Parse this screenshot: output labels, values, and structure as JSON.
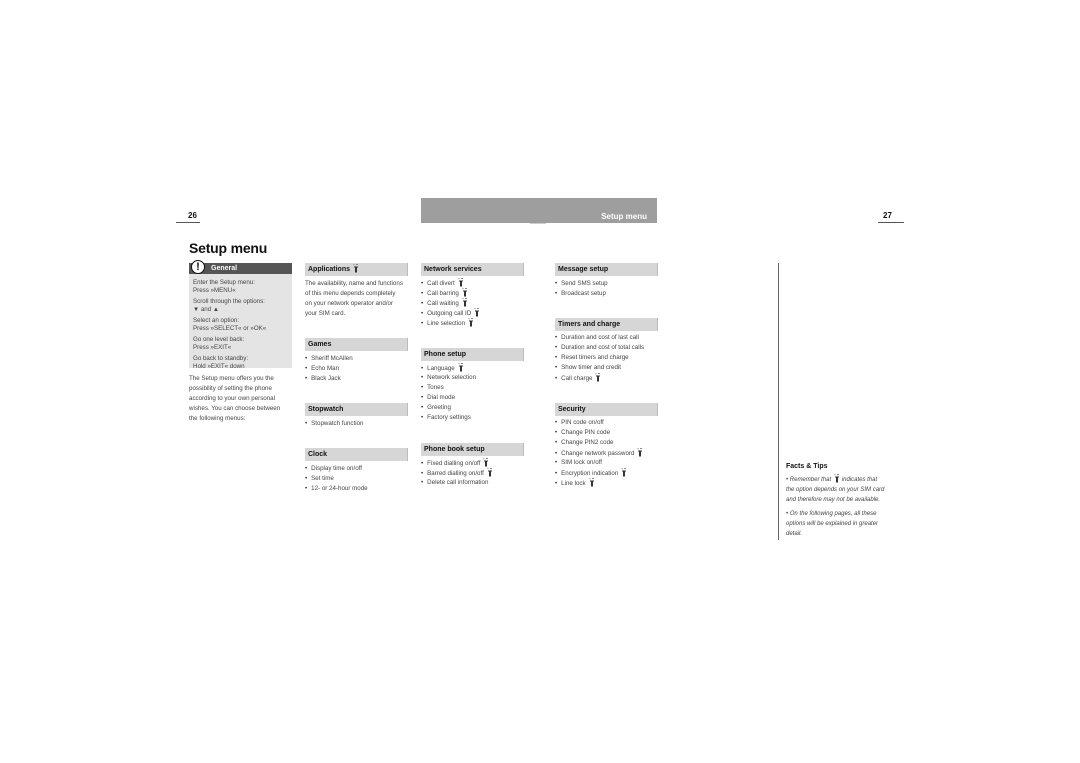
{
  "header": {
    "page_left": "26",
    "page_right": "27",
    "section_label": "Setup menu"
  },
  "title": "Setup menu",
  "general": {
    "heading": "General",
    "icon": "exclamation-icon",
    "instructions": [
      {
        "line1": "Enter the Setup menu:",
        "line2": "Press »MENU«"
      },
      {
        "line1": "Scroll through the options:",
        "line2": "▼ and ▲"
      },
      {
        "line1": "Select an option:",
        "line2": "Press »SELECT« or »OK«"
      },
      {
        "line1": "Go one level back:",
        "line2": "Press »EXIT«"
      },
      {
        "line1": "Go back to standby:",
        "line2": "Hold »EXIT« down"
      }
    ]
  },
  "intro": [
    "The Setup menu offers you the",
    "possibility of setting the phone",
    "according to your own personal",
    "wishes. You can choose between",
    "the following menus:"
  ],
  "sections": {
    "applications": {
      "heading": "Applications",
      "sim": true,
      "text": [
        "The availability, name and functions",
        "of this menu depends completely",
        "on your network operator and/or",
        "your SIM card."
      ]
    },
    "games": {
      "heading": "Games",
      "items": [
        {
          "label": "Sheriff McAllen"
        },
        {
          "label": "Echo Man"
        },
        {
          "label": "Black Jack"
        }
      ]
    },
    "stopwatch": {
      "heading": "Stopwatch",
      "items": [
        {
          "label": "Stopwatch function"
        }
      ]
    },
    "clock": {
      "heading": "Clock",
      "items": [
        {
          "label": "Display time on/off"
        },
        {
          "label": "Set time"
        },
        {
          "label": "12- or 24-hour mode"
        }
      ]
    },
    "network_services": {
      "heading": "Network services",
      "items": [
        {
          "label": "Call divert",
          "sim": true
        },
        {
          "label": "Call barring",
          "sim": true
        },
        {
          "label": "Call waiting",
          "sim": true
        },
        {
          "label": "Outgoing call ID",
          "sim": true
        },
        {
          "label": "Line selection",
          "sim": true
        }
      ]
    },
    "phone_setup": {
      "heading": "Phone setup",
      "items": [
        {
          "label": "Language",
          "sim": true
        },
        {
          "label": "Network selection"
        },
        {
          "label": "Tones"
        },
        {
          "label": "Dial mode"
        },
        {
          "label": "Greeting"
        },
        {
          "label": "Factory settings"
        }
      ]
    },
    "phone_book_setup": {
      "heading": "Phone book setup",
      "items": [
        {
          "label": "Fixed dialling on/off",
          "sim": true
        },
        {
          "label": "Barred dialling on/off",
          "sim": true
        },
        {
          "label": "Delete call information"
        }
      ]
    },
    "message_setup": {
      "heading": "Message setup",
      "items": [
        {
          "label": "Send SMS setup"
        },
        {
          "label": "Broadcast setup"
        }
      ]
    },
    "timers_and_charge": {
      "heading": "Timers and charge",
      "items": [
        {
          "label": "Duration and cost of last call"
        },
        {
          "label": "Duration and cost of total calls"
        },
        {
          "label": "Reset timers and charge"
        },
        {
          "label": "Show timer and credit"
        },
        {
          "label": "Call charge",
          "sim": true
        }
      ]
    },
    "security": {
      "heading": "Security",
      "items": [
        {
          "label": "PIN code on/off"
        },
        {
          "label": "Change PIN code"
        },
        {
          "label": "Change PIN2 code"
        },
        {
          "label": "Change network password",
          "sim": true
        },
        {
          "label": "SIM lock on/off"
        },
        {
          "label": "Encryption indication",
          "sim": true
        },
        {
          "label": "Line lock",
          "sim": true
        }
      ]
    }
  },
  "facts": {
    "title": "Facts & Tips",
    "tip1_before": "• Remember that",
    "tip1_after": "indicates that",
    "tip1_lines": [
      "the option depends on your SIM card",
      "and therefore may not be available."
    ],
    "tip2_lines": [
      "• On the following pages, all these",
      "options will be explained in greater",
      "detail."
    ]
  }
}
